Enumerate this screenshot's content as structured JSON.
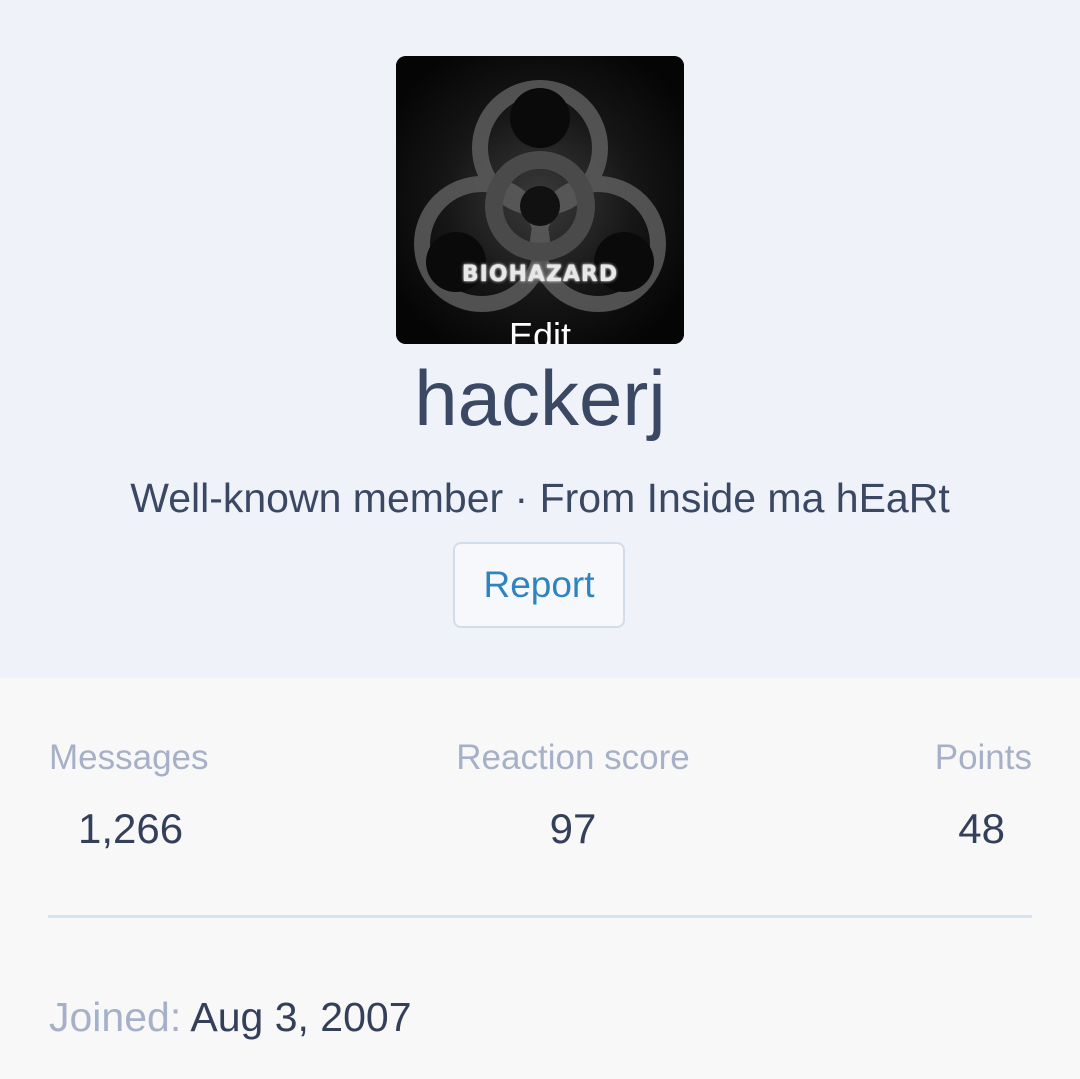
{
  "profile": {
    "avatar": {
      "banner_text": "BIOHAZARD",
      "edit_label": "Edit"
    },
    "username": "hackerj",
    "user_title": "Well-known member · From Inside ma hEaRt",
    "report_label": "Report"
  },
  "stats": [
    {
      "label": "Messages",
      "value": "1,266"
    },
    {
      "label": "Reaction score",
      "value": "97"
    },
    {
      "label": "Points",
      "value": "48"
    }
  ],
  "joined": {
    "label": "Joined:",
    "value": "Aug 3, 2007"
  },
  "colors": {
    "header_background": "#eff2f9",
    "body_background": "#f8f8f9",
    "primary_text": "#3a4863",
    "muted_text": "#a6b1c7",
    "link": "#2f84bf",
    "divider": "#d8e4f1"
  },
  "icons": {
    "avatar_symbol": "biohazard-icon"
  }
}
